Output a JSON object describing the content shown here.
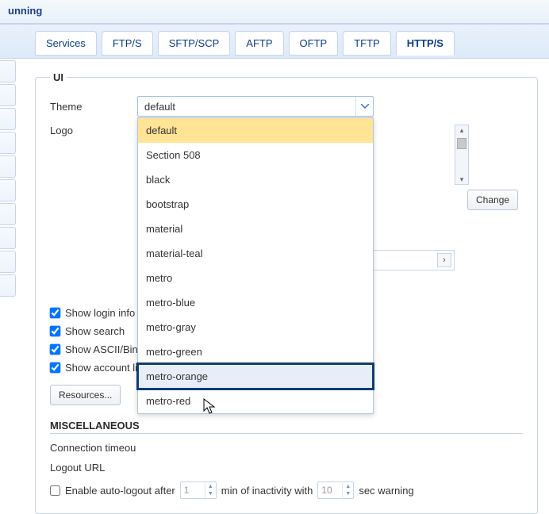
{
  "banner": {
    "status_fragment": "unning"
  },
  "tabs": [
    {
      "label": "Services"
    },
    {
      "label": "FTP/S"
    },
    {
      "label": "SFTP/SCP"
    },
    {
      "label": "AFTP"
    },
    {
      "label": "OFTP"
    },
    {
      "label": "TFTP"
    },
    {
      "label": "HTTP/S",
      "active": true
    }
  ],
  "ui_group": {
    "legend": "UI",
    "theme_label": "Theme",
    "theme_value": "default",
    "theme_options": [
      "default",
      "Section 508",
      "black",
      "bootstrap",
      "material",
      "material-teal",
      "metro",
      "metro-blue",
      "metro-gray",
      "metro-green",
      "metro-orange",
      "metro-red"
    ],
    "theme_selected_index": 0,
    "theme_hover_index": 10,
    "logo_label": "Logo",
    "change_btn": "Change",
    "checks": {
      "show_login_info": {
        "label": "Show login info",
        "checked": true
      },
      "show_search": {
        "label": "Show search",
        "checked": true
      },
      "show_ascii_binary": {
        "label": "Show ASCII/Binar",
        "checked": true
      },
      "show_account_link": {
        "label": "Show account lin",
        "checked": true
      }
    },
    "resources_btn": "Resources..."
  },
  "misc": {
    "heading": "MISCELLANEOUS",
    "connection_timeout_label": "Connection timeou",
    "logout_url_label": "Logout URL",
    "auto_logout_checked": false,
    "auto_logout_text_1": "Enable auto-logout after",
    "auto_logout_minutes": "1",
    "auto_logout_text_2": "min of inactivity with",
    "auto_logout_warning": "10",
    "auto_logout_text_3": "sec warning"
  }
}
